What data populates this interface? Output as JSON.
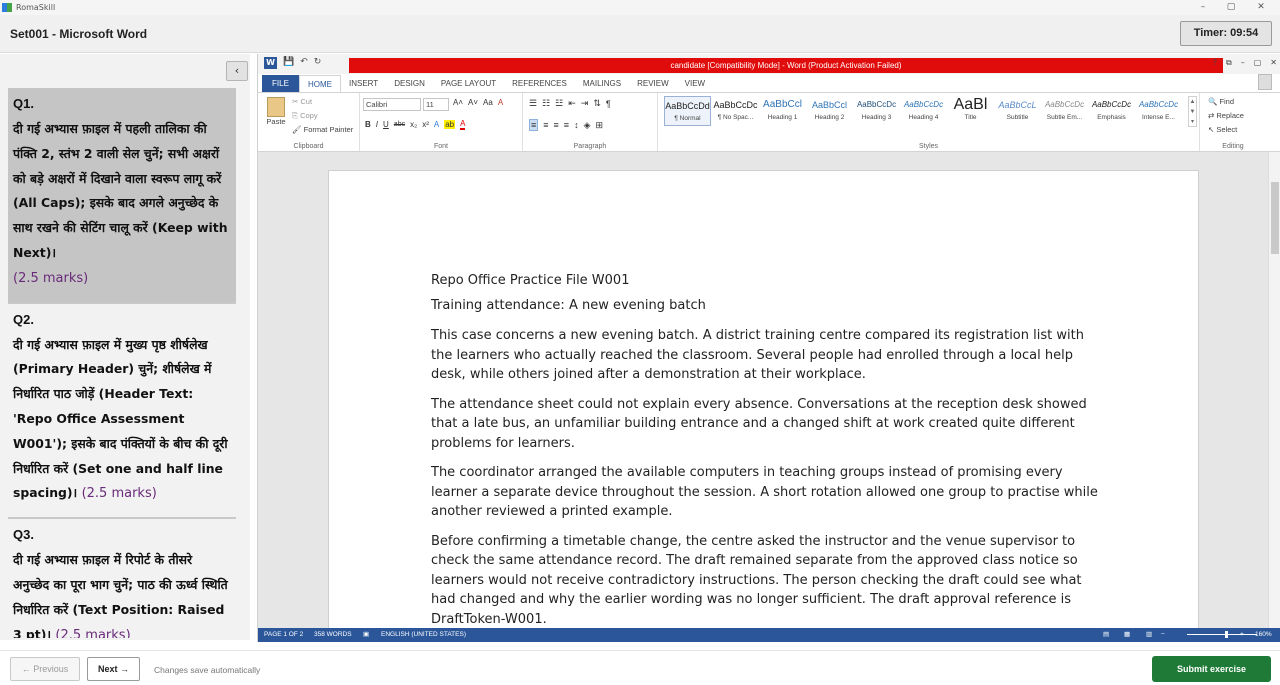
{
  "os_window": {
    "title": "RomaSkill",
    "minimize": "–",
    "maximize": "▢",
    "close": "✕"
  },
  "app": {
    "title": "Set001 - Microsoft Word",
    "timer": "Timer: 09:54",
    "collapse_glyph": "‹"
  },
  "questions": [
    {
      "number": "Q1.",
      "text": "दी गई अभ्यास फ़ाइल में पहली तालिका की पंक्ति 2, स्तंभ 2 वाली सेल चुनें; सभी अक्षरों को बड़े अक्षरों में दिखाने वाला स्वरूप लागू करें (All Caps); इसके बाद अगले अनुच्छेद के साथ रखने की सेटिंग चालू करें (Keep with Next)।",
      "marks": "(2.5 marks)",
      "active": true
    },
    {
      "number": "Q2.",
      "text": "दी गई अभ्यास फ़ाइल में मुख्य पृष्ठ शीर्षलेख (Primary Header) चुनें; शीर्षलेख में निर्धारित पाठ जोड़ें (Header Text: 'Repo Office Assessment W001'); इसके बाद पंक्तियों के बीच की दूरी निर्धारित करें (Set one and half line spacing)।",
      "marks": "(2.5 marks)",
      "active": false
    },
    {
      "number": "Q3.",
      "text": "दी गई अभ्यास फ़ाइल में रिपोर्ट के तीसरे अनुच्छेद का पूरा भाग चुनें; पाठ की ऊर्ध्व स्थिति निर्धारित करें (Text Position: Raised 3 pt)।",
      "marks": "(2.5 marks)",
      "active": false
    }
  ],
  "word": {
    "title_bar": "candidate [Compatibility Mode] - Word (Product Activation Failed)",
    "qat": {
      "word_icon": "W",
      "save": "💾",
      "undo": "↶",
      "redo": "↻"
    },
    "window_controls": {
      "help": "?",
      "restore": "⧉",
      "minimize": "–",
      "maximize": "▢",
      "close": "✕"
    },
    "tabs": [
      "FILE",
      "HOME",
      "INSERT",
      "DESIGN",
      "PAGE LAYOUT",
      "REFERENCES",
      "MAILINGS",
      "REVIEW",
      "VIEW"
    ],
    "active_tab": "HOME",
    "ribbon": {
      "clipboard": {
        "label": "Clipboard",
        "paste": "Paste",
        "cut": "Cut",
        "copy": "Copy",
        "format_painter": "Format Painter"
      },
      "font": {
        "label": "Font",
        "name": "Calibri",
        "size": "11",
        "bold": "B",
        "italic": "I",
        "underline": "U",
        "strike": "abc",
        "subscript": "x₂",
        "superscript": "x²",
        "grow": "A˄",
        "shrink": "A˅",
        "case": "Aa",
        "clear": "A",
        "effects": "A",
        "highlight": "ab",
        "color": "A"
      },
      "paragraph": {
        "label": "Paragraph"
      },
      "styles": {
        "label": "Styles",
        "items": [
          {
            "preview": "AaBbCcDd",
            "name": "¶ Normal"
          },
          {
            "preview": "AaBbCcDc",
            "name": "¶ No Spac..."
          },
          {
            "preview": "AaBbCcl",
            "name": "Heading 1"
          },
          {
            "preview": "AaBbCcl",
            "name": "Heading 2"
          },
          {
            "preview": "AaBbCcDc",
            "name": "Heading 3"
          },
          {
            "preview": "AaBbCcDc",
            "name": "Heading 4"
          },
          {
            "preview": "AaBl",
            "name": "Title"
          },
          {
            "preview": "AaBbCcL",
            "name": "Subtitle"
          },
          {
            "preview": "AaBbCcDc",
            "name": "Subtle Em..."
          },
          {
            "preview": "AaBbCcDc",
            "name": "Emphasis"
          },
          {
            "preview": "AaBbCcDc",
            "name": "Intense E..."
          }
        ]
      },
      "editing": {
        "label": "Editing",
        "find": "Find",
        "replace": "Replace",
        "select": "Select"
      }
    },
    "document": {
      "paragraphs": [
        "Repo Office Practice File W001",
        "Training attendance: A new evening batch",
        "This case concerns a new evening batch. A district training centre compared its registration list with the learners who actually reached the classroom. Several people had enrolled through a local help desk, while others joined after a demonstration at their workplace.",
        "The attendance sheet could not explain every absence. Conversations at the reception desk showed that a late bus, an unfamiliar building entrance and a changed shift at work created quite different problems for learners.",
        "The coordinator arranged the available computers in teaching groups instead of promising every learner a separate device throughout the session. A short rotation allowed one group to practise while another reviewed a printed example.",
        "Before confirming a timetable change, the centre asked the instructor and the venue supervisor to check the same attendance record. The draft remained separate from the approved class notice so learners would not receive contradictory instructions. The person checking the draft could see what had changed and why the earlier wording was no longer sufficient. The draft approval reference is DraftToken-W001."
      ]
    },
    "status": {
      "page": "PAGE 1 OF 2",
      "words": "358 WORDS",
      "language": "ENGLISH (UNITED STATES)",
      "zoom": "160%",
      "zoom_minus": "−",
      "zoom_plus": "+"
    }
  },
  "footer": {
    "previous": "← Previous",
    "next": "Next →",
    "autosave": "Changes save automatically",
    "submit": "Submit exercise"
  },
  "colors": {
    "title_bar_red": "#e00b0b",
    "word_blue": "#2b579a",
    "submit_green": "#1f7a37",
    "marks_purple": "#6a2a7a"
  }
}
